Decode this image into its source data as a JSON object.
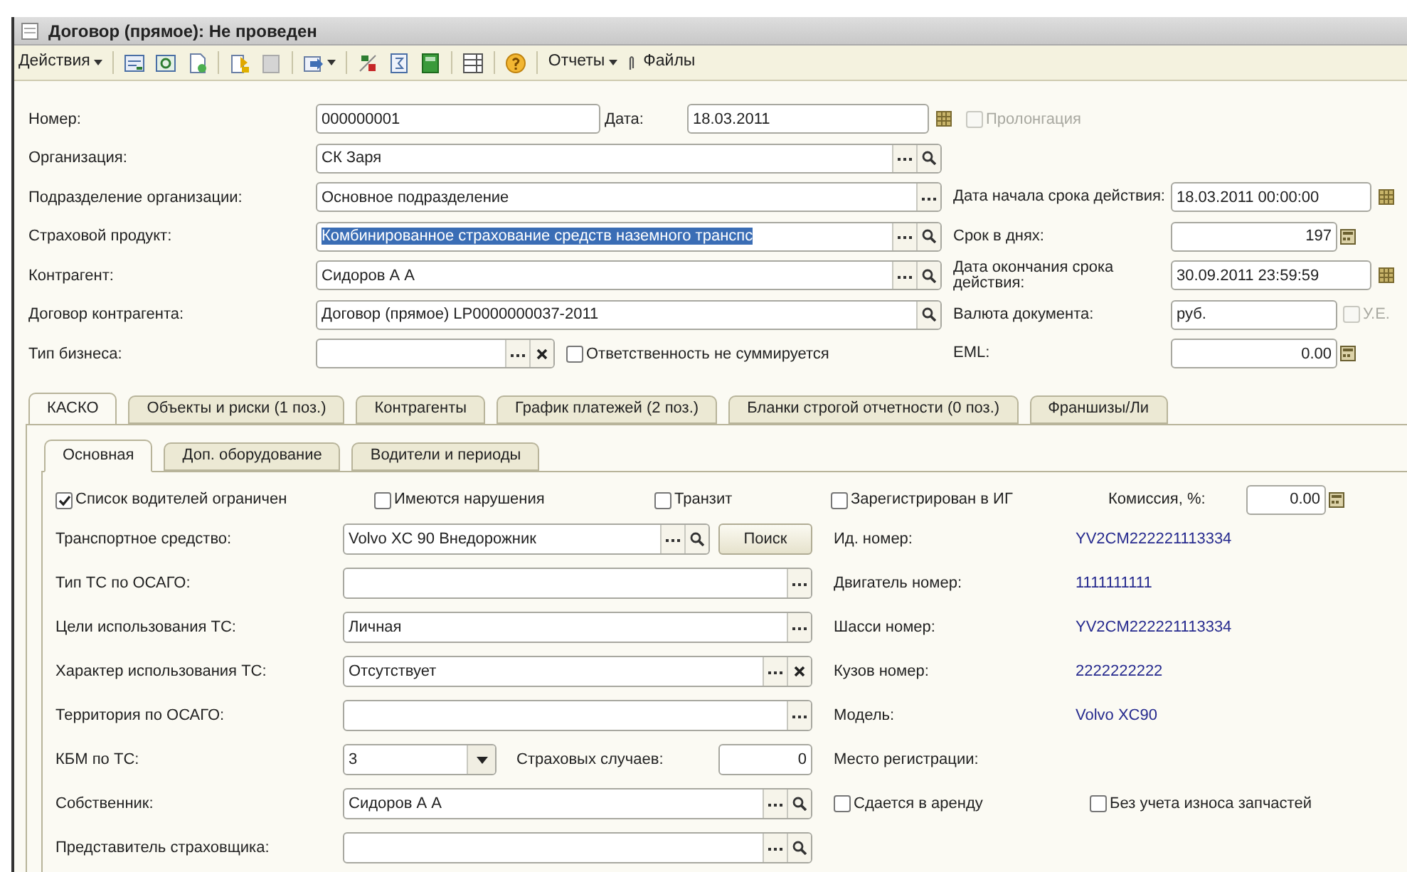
{
  "window": {
    "title": "Договор (прямое): Не проведен"
  },
  "toolbar": {
    "actions_menu": "Действия",
    "reports_menu": "Отчеты",
    "files_button": "Файлы"
  },
  "header": {
    "number": {
      "label": "Номер:",
      "value": "000000001"
    },
    "date": {
      "label": "Дата:",
      "value": "18.03.2011"
    },
    "prolongation": {
      "label": "Пролонгация",
      "checked": false,
      "disabled": true
    },
    "left_fields": [
      {
        "label": "Организация:",
        "value": "СК Заря",
        "buttons": [
          {
            "kind": "choose"
          },
          {
            "kind": "open"
          }
        ],
        "highlighted": false
      },
      {
        "label": "Подразделение организации:",
        "value": "Основное подразделение",
        "buttons": [
          {
            "kind": "choose"
          }
        ],
        "highlighted": false
      },
      {
        "label": "Страховой продукт:",
        "value": "Комбинированное страхование средств наземного транспс",
        "buttons": [
          {
            "kind": "choose"
          },
          {
            "kind": "open"
          }
        ],
        "highlighted": true
      },
      {
        "label": "Контрагент:",
        "value": "Сидоров А А",
        "buttons": [
          {
            "kind": "choose"
          },
          {
            "kind": "open"
          }
        ],
        "highlighted": false
      },
      {
        "label": "Договор контрагента:",
        "value": "Договор (прямое) LP0000000037-2011",
        "buttons": [
          {
            "kind": "open"
          }
        ],
        "highlighted": false
      }
    ],
    "business_type": {
      "label": "Тип бизнеса:",
      "buttons": [
        {
          "kind": "choose"
        },
        {
          "kind": "clear"
        }
      ]
    },
    "liability_checkbox": {
      "label": "Ответственность не суммируется",
      "checked": false,
      "disabled": false
    },
    "right_fields": [
      {
        "kind": "date",
        "label": "Дата начала срока действия:",
        "value": "18.03.2011 00:00:00"
      },
      {
        "kind": "number",
        "label": "Срок в днях:",
        "value": "197"
      },
      {
        "kind": "date",
        "label": "Дата окончания срока действия:",
        "value": "30.09.2011 23:59:59"
      },
      {
        "kind": "choice",
        "label": "Валюта документа:",
        "value": "руб."
      },
      {
        "kind": "number",
        "label": "EML:",
        "value": "0.00"
      }
    ],
    "ue_checkbox": {
      "label": "У.Е.",
      "checked": false,
      "disabled": true
    }
  },
  "tabs": [
    {
      "label": "КАСКО",
      "selected": true
    },
    {
      "label": "Объекты и риски (1 поз.)",
      "selected": false
    },
    {
      "label": "Контрагенты",
      "selected": false
    },
    {
      "label": "График платежей (2 поз.)",
      "selected": false
    },
    {
      "label": "Бланки строгой отчетности (0 поз.)",
      "selected": false
    },
    {
      "label": "Франшизы/Ли",
      "selected": false
    }
  ],
  "subtabs": [
    {
      "label": "Основная",
      "selected": true
    },
    {
      "label": "Доп. оборудование",
      "selected": false
    },
    {
      "label": "Водители и периоды",
      "selected": false
    }
  ],
  "kasko": {
    "checkboxes": [
      {
        "label": "Список водителей ограничен",
        "checked": true,
        "disabled": false
      },
      {
        "label": "Имеются нарушения",
        "checked": false,
        "disabled": false
      },
      {
        "label": "Транзит",
        "checked": false,
        "disabled": false
      }
    ],
    "registration_checkbox": {
      "label": "Зарегистрирован в ИГ",
      "checked": false,
      "disabled": false
    },
    "commission": {
      "label": "Комиссия, %:",
      "value": "0.00"
    },
    "vehicle_fields": [
      {
        "kind": "field",
        "label": "Транспортное средство:",
        "value": "Volvo XC 90 Внедорожник",
        "buttons": [
          {
            "kind": "choose"
          },
          {
            "kind": "open"
          }
        ],
        "action_button": "Поиск"
      },
      {
        "kind": "field",
        "label": "Тип ТС по ОСАГО:",
        "buttons": [
          {
            "kind": "choose"
          }
        ]
      },
      {
        "kind": "field",
        "label": "Цели использования ТС:",
        "value": "Личная",
        "buttons": [
          {
            "kind": "choose"
          }
        ]
      },
      {
        "kind": "field",
        "label": "Характер использования ТС:",
        "value": "Отсутствует",
        "buttons": [
          {
            "kind": "choose"
          },
          {
            "kind": "clear"
          }
        ]
      },
      {
        "kind": "field",
        "label": "Территория по ОСАГО:",
        "buttons": [
          {
            "kind": "choose"
          }
        ]
      },
      {
        "kind": "dropdown",
        "label": "КБМ по ТС:",
        "value": "3",
        "counter": {
          "label": "Страховых случаев:",
          "value": "0"
        }
      },
      {
        "kind": "field",
        "label": "Собственник:",
        "value": "Сидоров А А",
        "buttons": [
          {
            "kind": "choose"
          },
          {
            "kind": "open"
          }
        ]
      },
      {
        "kind": "field",
        "label": "Представитель страховщика:",
        "buttons": [
          {
            "kind": "choose"
          },
          {
            "kind": "open"
          }
        ]
      }
    ],
    "vehicle_info": [
      {
        "label": "Ид. номер:",
        "value": "YV2CM222221113334"
      },
      {
        "label": "Двигатель номер:",
        "value": "1111111111"
      },
      {
        "label": "Шасси номер:",
        "value": "YV2CM222221113334"
      },
      {
        "label": "Кузов номер:",
        "value": "2222222222"
      },
      {
        "label": "Модель:",
        "value": "Volvo XC90"
      },
      {
        "label": "Место регистрации:"
      }
    ],
    "extra_checkboxes": [
      {
        "label": "Сдается в аренду",
        "checked": false,
        "disabled": false
      },
      {
        "label": "Без учета износа запчастей",
        "checked": false,
        "disabled": false
      }
    ]
  }
}
